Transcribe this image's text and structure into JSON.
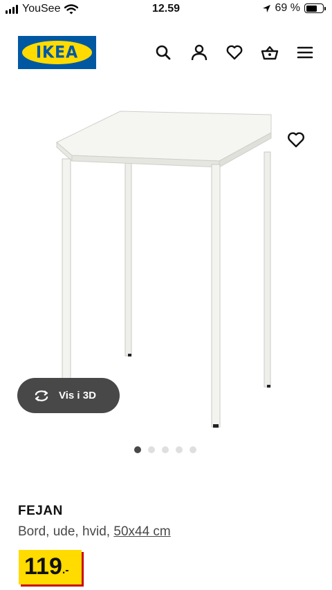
{
  "status_bar": {
    "carrier": "YouSee",
    "time": "12.59",
    "battery_percent": "69 %",
    "battery_level": 0.69
  },
  "header": {
    "logo_text": "IKEA",
    "brand_colors": {
      "blue": "#0058a3",
      "yellow": "#ffdb00"
    },
    "icons": [
      "search-icon",
      "account-icon",
      "favorites-icon",
      "basket-icon",
      "menu-icon"
    ]
  },
  "gallery": {
    "view_3d_label": "Vis i 3D",
    "image_count": 5,
    "active_index": 0
  },
  "product": {
    "name": "FEJAN",
    "description": "Bord, ude, hvid, ",
    "dimensions": "50x44 cm",
    "price_integer": "119",
    "price_suffix": ".-",
    "price_accent": "#cc0008"
  }
}
